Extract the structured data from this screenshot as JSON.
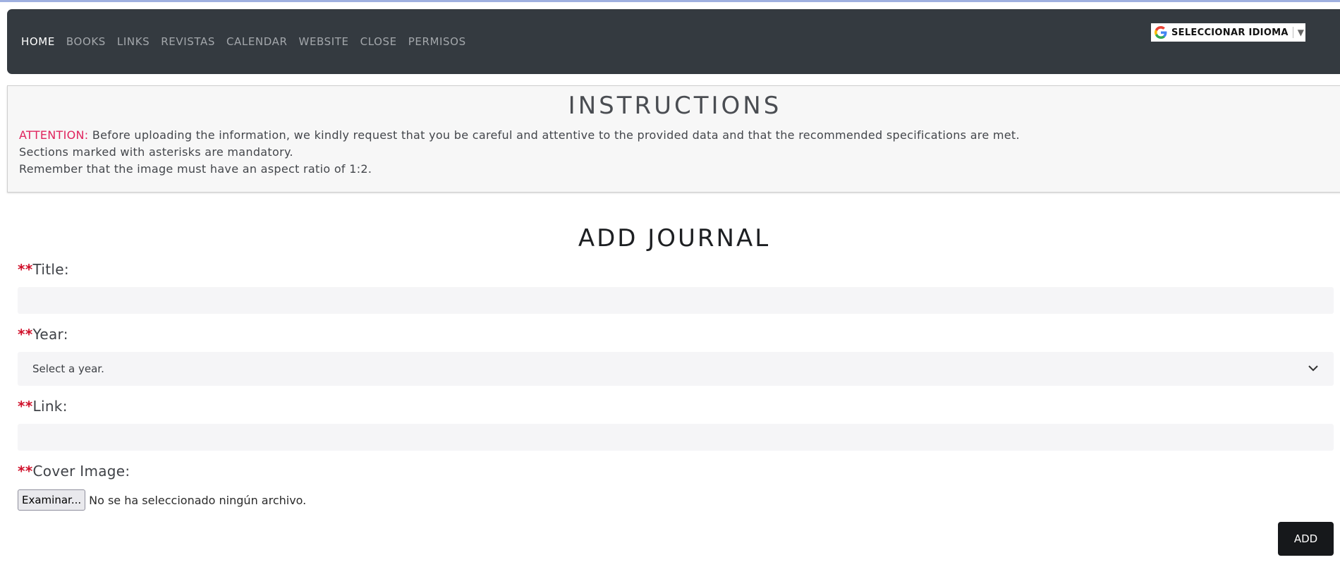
{
  "nav": {
    "items": [
      {
        "label": "HOME",
        "active": true
      },
      {
        "label": "BOOKS"
      },
      {
        "label": "LINKS"
      },
      {
        "label": "REVISTAS"
      },
      {
        "label": "CALENDAR"
      },
      {
        "label": "WEBSITE"
      },
      {
        "label": "CLOSE"
      },
      {
        "label": "PERMISOS"
      }
    ],
    "translate_label": "SELECCIONAR IDIOMA",
    "translate_arrow": "▼"
  },
  "instructions": {
    "title": "INSTRUCTIONS",
    "attention_label": "ATTENTION:",
    "line1": " Before uploading the information, we kindly request that you be careful and attentive to the provided data and that the recommended specifications are met.",
    "line2": "Sections marked with asterisks are mandatory.",
    "line3": "Remember that the image must have an aspect ratio of 1:2."
  },
  "form": {
    "title": "ADD JOURNAL",
    "required_marker": "**",
    "title_label": "Title:",
    "title_value": "",
    "year_label": "Year:",
    "year_selected": "Select a year.",
    "link_label": "Link:",
    "link_value": "",
    "cover_label": "Cover Image:",
    "file_button": "Examinar...",
    "file_status": "No se ha seleccionado ningún archivo.",
    "submit": "ADD"
  },
  "colors": {
    "navbar": "#343a40",
    "attention": "#e0245e",
    "required": "#d0102a",
    "button": "#16181b"
  }
}
